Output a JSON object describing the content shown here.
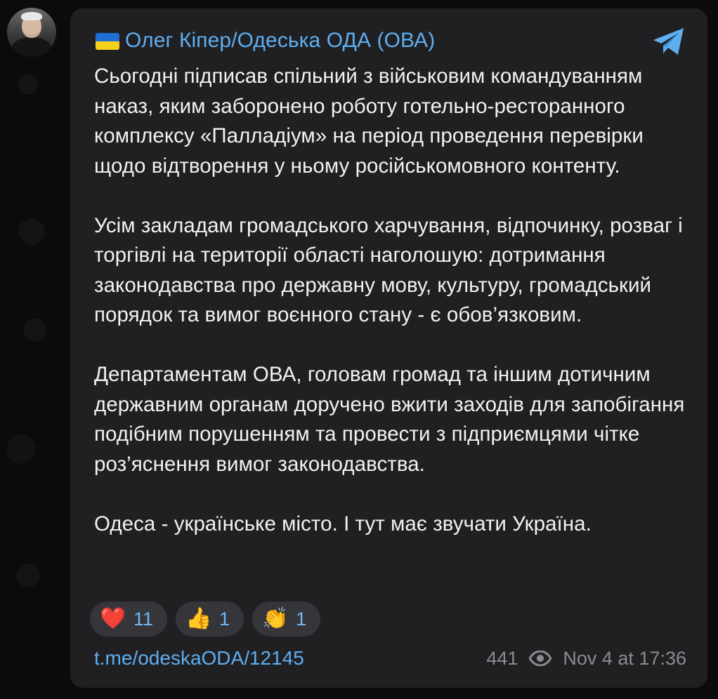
{
  "channel": {
    "name": "Олег Кіпер/Одеська ОДА (ОВА)",
    "flag_icon": "ukraine-flag",
    "avatar_icon": "user-avatar"
  },
  "message": {
    "paragraphs": [
      "Сьогодні підписав спільний з військовим командуванням наказ, яким заборонено роботу готельно-ресторанного комплексу «Палладіум» на період проведення перевірки щодо відтворення у ньому російськомовного контенту.",
      "Усім закладам громадського харчування, відпочинку, розваг і торгівлі на території області наголошую: дотримання законодавства про державну мову, культуру, громадський порядок та вимог воєнного стану - є обов’язковим.",
      "Департаментам ОВА, головам громад та іншим дотичним державним органам доручено вжити заходів для запобігання подібним порушенням та провести з підприємцями чітке роз’яснення вимог законодавства.",
      "Одеса - українське місто. І тут має звучати Україна."
    ]
  },
  "reactions": [
    {
      "emoji": "❤️",
      "count": "11"
    },
    {
      "emoji": "👍",
      "count": "1"
    },
    {
      "emoji": "👏",
      "count": "1"
    }
  ],
  "footer": {
    "link": "t.me/odeskaODA/12145",
    "views": "441",
    "timestamp": "Nov 4 at 17:36"
  },
  "colors": {
    "background": "#0b0b0c",
    "bubble": "#202022",
    "accent": "#5eaef0",
    "text": "#f2f2f2",
    "meta": "#8b8b90",
    "reaction_bg": "#35353a"
  }
}
